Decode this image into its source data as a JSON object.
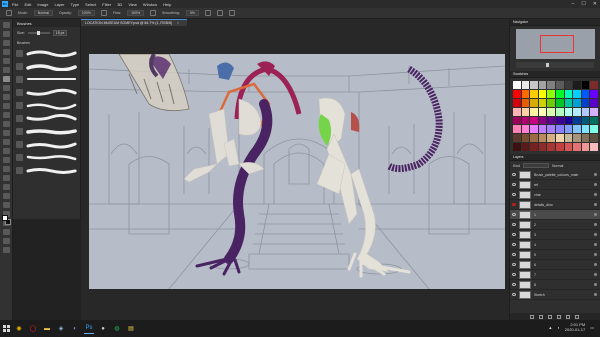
{
  "app": {
    "logo_text": "Ps"
  },
  "menubar": {
    "items": [
      "File",
      "Edit",
      "Image",
      "Layer",
      "Type",
      "Select",
      "Filter",
      "3D",
      "View",
      "Window",
      "Help"
    ],
    "window_controls": [
      "–",
      "☐",
      "✕"
    ]
  },
  "options_bar": {
    "mode_label": "Mode:",
    "mode_value": "Normal",
    "opacity_label": "Opacity:",
    "opacity_value": "100%",
    "flow_label": "Flow:",
    "flow_value": "100%",
    "smoothing_label": "Smoothing:",
    "smoothing_value": "0%"
  },
  "document": {
    "tab_title": "LOCATION MUSEUM SOMEY.psd @ 66.7% (1, RGB/8)",
    "close_glyph": "×"
  },
  "brush_panel": {
    "title": "Brushes",
    "size_label": "Size:",
    "size_value": "15 px",
    "folder_name": "Brushes",
    "brush_count": 10
  },
  "tools": {
    "count": 26,
    "active_index": 6,
    "foreground_color": "#ffffff",
    "background_color": "#111111"
  },
  "navigator": {
    "title": "Navigator"
  },
  "swatches": {
    "title": "Swatches",
    "colors": [
      "#ffffff",
      "#e8e8e8",
      "#c7c7c7",
      "#a3a3a3",
      "#808080",
      "#5c5c5c",
      "#3a3a3a",
      "#1c1c1c",
      "#000000",
      "#7d2b2b",
      "#ff0000",
      "#ff6a00",
      "#ffcc00",
      "#ffff00",
      "#8dff00",
      "#00ff2a",
      "#00ffb7",
      "#00d0ff",
      "#0056ff",
      "#6a00ff",
      "#d4000b",
      "#e35e00",
      "#d7ab00",
      "#cfd000",
      "#6ecb00",
      "#00c52a",
      "#00c6a0",
      "#00a2d4",
      "#0040cc",
      "#5a00c9",
      "#ffb3b3",
      "#ffd0a6",
      "#fff0a3",
      "#fffcb8",
      "#d9ffb0",
      "#b3ffc1",
      "#b3ffed",
      "#b3ecff",
      "#b3c8ff",
      "#d3b3ff",
      "#a0005a",
      "#b0006f",
      "#c7007f",
      "#8a0082",
      "#5e0090",
      "#3d0094",
      "#1d009a",
      "#003c9a",
      "#005a7a",
      "#00705f",
      "#ff80b5",
      "#ff7fd5",
      "#e87fff",
      "#c07fff",
      "#a47fff",
      "#8a7fff",
      "#7f9eff",
      "#7fc6ff",
      "#7fe4ff",
      "#7fffe6",
      "#5a3a2a",
      "#7a4e33",
      "#9b6a46",
      "#b98a60",
      "#d6ad80",
      "#efd3ac",
      "#c8b89a",
      "#a89578",
      "#83705a",
      "#5d4f3e",
      "#3a1010",
      "#5a1a1a",
      "#742222",
      "#8e2b2b",
      "#a83434",
      "#c34040",
      "#d85555",
      "#e57272",
      "#f09696",
      "#f7bdbd"
    ]
  },
  "layers": {
    "title": "Layers",
    "kind_label": "Kind",
    "blend_label": "Normal",
    "rows": [
      {
        "name": "Brush_palette_colours_main",
        "visible": true,
        "selected": false
      },
      {
        "name": "ref",
        "visible": true,
        "selected": false
      },
      {
        "name": "char",
        "visible": true,
        "selected": false
      },
      {
        "name": "details_dino",
        "visible": false,
        "selected": false
      },
      {
        "name": "1",
        "visible": true,
        "selected": true
      },
      {
        "name": "2",
        "visible": true,
        "selected": false
      },
      {
        "name": "3",
        "visible": true,
        "selected": false
      },
      {
        "name": "4",
        "visible": true,
        "selected": false
      },
      {
        "name": "5",
        "visible": true,
        "selected": false
      },
      {
        "name": "6",
        "visible": true,
        "selected": false
      },
      {
        "name": "7",
        "visible": true,
        "selected": false
      },
      {
        "name": "8",
        "visible": true,
        "selected": false
      },
      {
        "name": "Sketch",
        "visible": true,
        "selected": false
      }
    ]
  },
  "taskbar": {
    "apps": [
      {
        "icon": "chrome-icon",
        "glyph": "◉",
        "color": "#e9b100",
        "active": false
      },
      {
        "icon": "opera-icon",
        "glyph": "◯",
        "color": "#ff1b2d",
        "active": false
      },
      {
        "icon": "explorer-icon",
        "glyph": "▬",
        "color": "#f2c84b",
        "active": false
      },
      {
        "icon": "steam-icon",
        "glyph": "◈",
        "color": "#8fb9d6",
        "active": false
      },
      {
        "icon": "discord-icon",
        "glyph": "◐",
        "color": "#7289da",
        "active": false
      },
      {
        "icon": "photoshop-icon",
        "glyph": "Ps",
        "color": "#31a8ff",
        "active": true
      },
      {
        "icon": "obs-icon",
        "glyph": "●",
        "color": "#cccccc",
        "active": false
      },
      {
        "icon": "spotify-icon",
        "glyph": "◍",
        "color": "#1db954",
        "active": false
      },
      {
        "icon": "notes-icon",
        "glyph": "▤",
        "color": "#f5d547",
        "active": false
      }
    ],
    "time": "2:01 PM",
    "date": "2020-01-17"
  }
}
